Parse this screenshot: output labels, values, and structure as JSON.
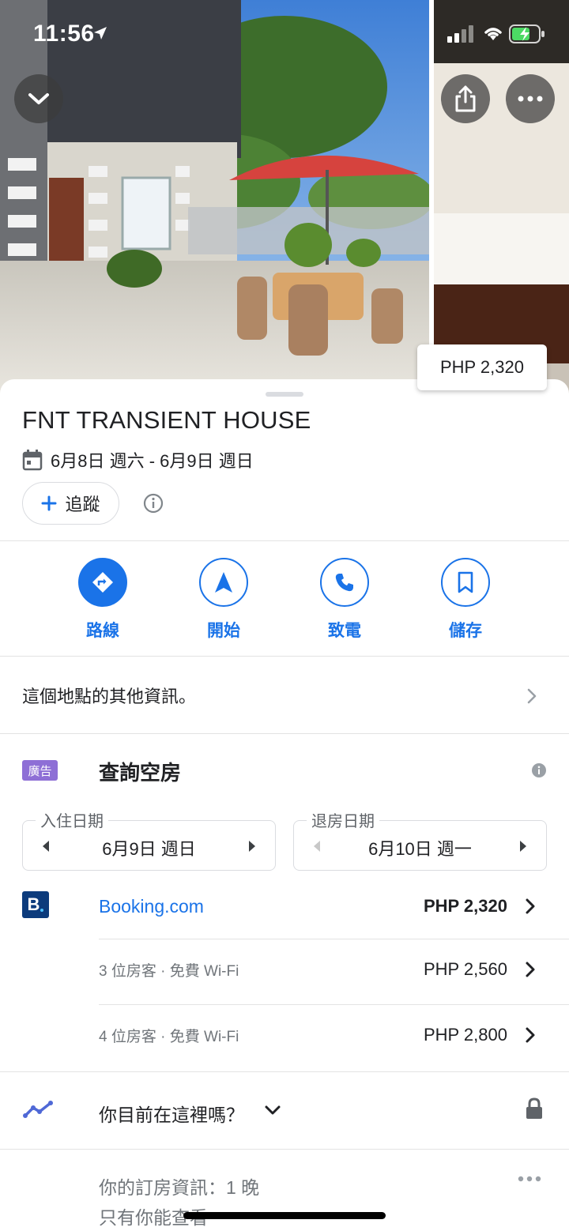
{
  "status_bar": {
    "time": "11:56"
  },
  "photos": {
    "price_chip": "PHP 2,320"
  },
  "place": {
    "title": "FNT TRANSIENT HOUSE",
    "dates": "6月8日 週六 - 6月9日 週日",
    "follow_label": "追蹤"
  },
  "actions": [
    {
      "label": "路線",
      "icon": "directions-icon"
    },
    {
      "label": "開始",
      "icon": "navigation-arrow-icon"
    },
    {
      "label": "致電",
      "icon": "phone-icon"
    },
    {
      "label": "儲存",
      "icon": "bookmark-icon"
    }
  ],
  "more_info": {
    "label": "這個地點的其他資訊。"
  },
  "availability": {
    "ad_badge": "廣告",
    "title": "查詢空房",
    "check_in": {
      "legend": "入住日期",
      "value": "6月9日 週日"
    },
    "check_out": {
      "legend": "退房日期",
      "value": "6月10日 週一"
    },
    "offers": [
      {
        "provider": "Booking.com",
        "price": "PHP 2,320"
      },
      {
        "desc": "3 位房客 · 免費 Wi-Fi",
        "price": "PHP 2,560"
      },
      {
        "desc": "4 位房客 · 免費 Wi-Fi",
        "price": "PHP 2,800"
      }
    ]
  },
  "here": {
    "question": "你目前在這裡嗎？"
  },
  "booking_info": {
    "line1": "你的訂房資訊：1 晚",
    "line2": "只有你能查看"
  },
  "colors": {
    "accent": "#1a73e8",
    "ad_badge": "#8e6fd6",
    "booking_brand": "#0c3b7c"
  }
}
